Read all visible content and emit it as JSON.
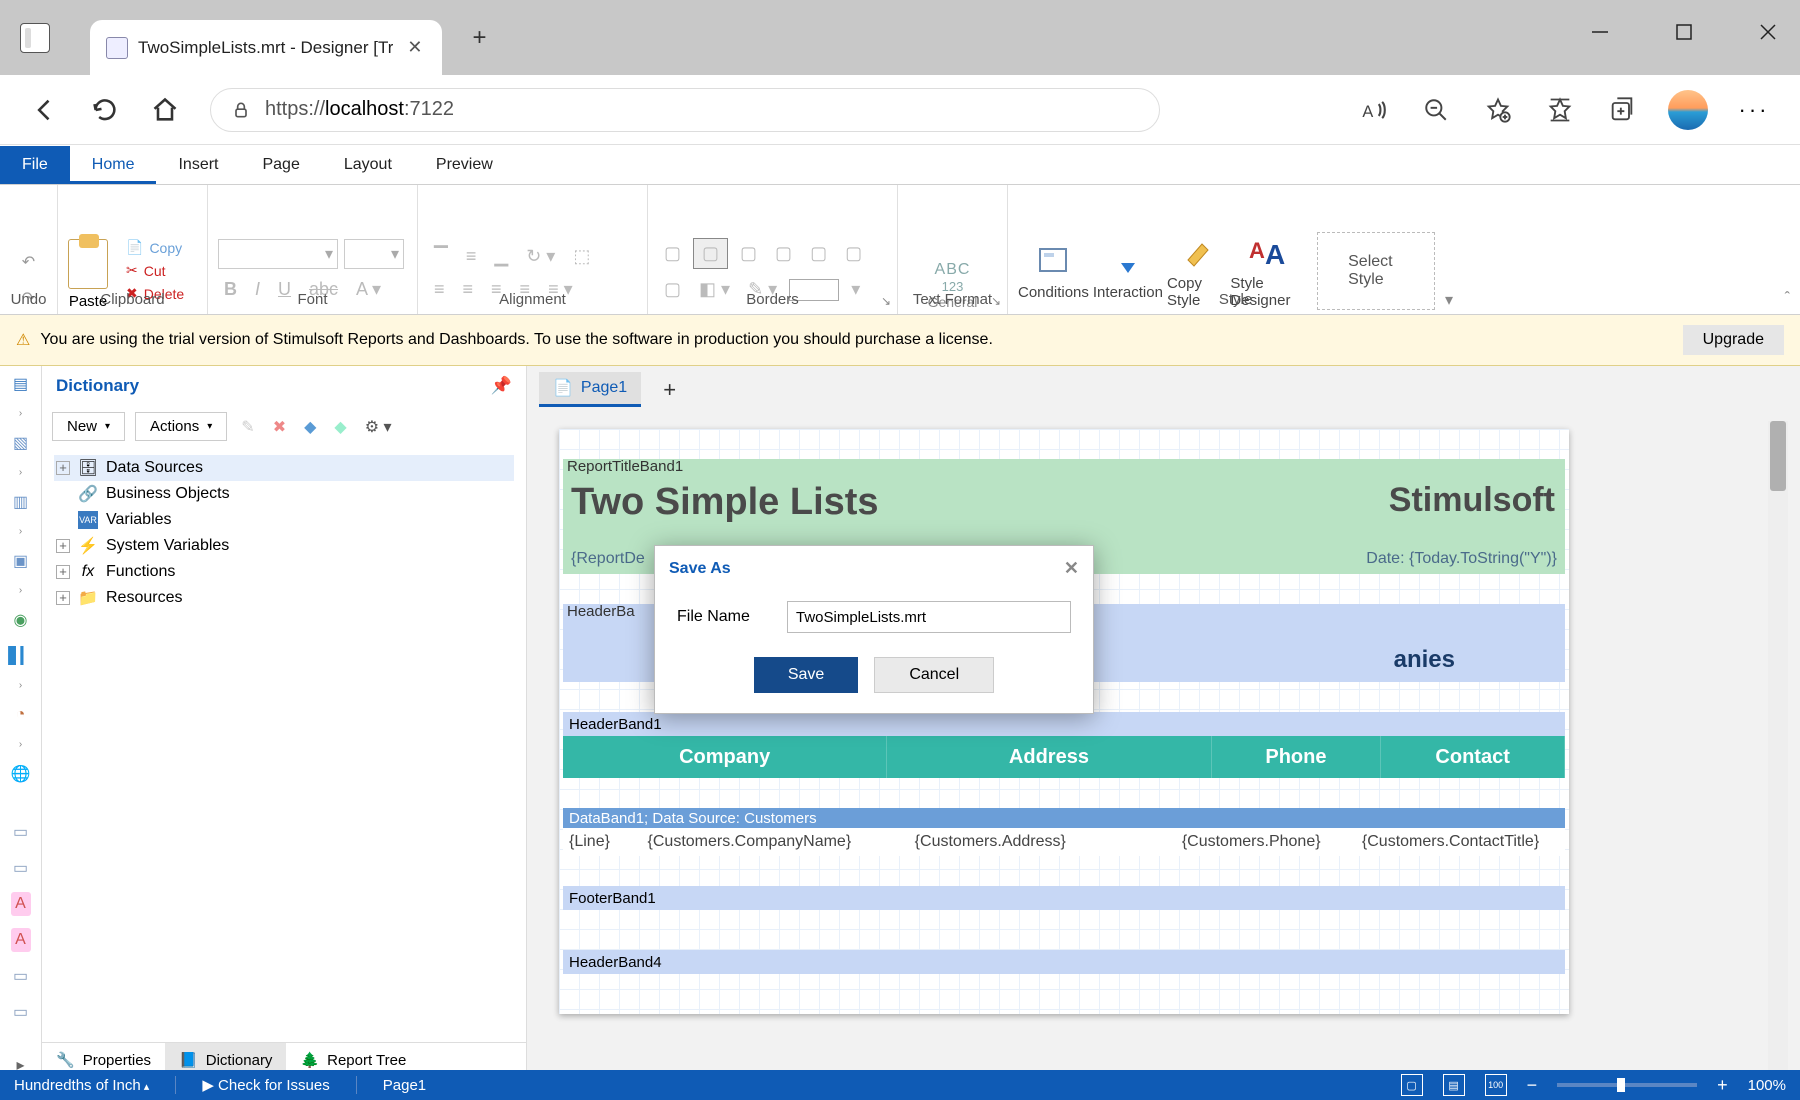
{
  "window": {
    "tab_title": "TwoSimpleLists.mrt - Designer [Tr",
    "new_tab": "+"
  },
  "addr": {
    "scheme": "https://",
    "host": "localhost",
    "port": ":7122"
  },
  "menu": {
    "file": "File",
    "home": "Home",
    "insert": "Insert",
    "page": "Page",
    "layout": "Layout",
    "preview": "Preview"
  },
  "ribbon": {
    "undo_label": "Undo",
    "paste": "Paste",
    "copy": "Copy",
    "cut": "Cut",
    "delete": "Delete",
    "clipboard_label": "Clipboard",
    "font_label": "Font",
    "alignment_label": "Alignment",
    "borders_label": "Borders",
    "textformat_label": "Text Format",
    "style_label": "Style",
    "abc": "ABC",
    "num123": "123",
    "general": "General",
    "conditions": "Conditions",
    "interaction": "Interaction",
    "copy_style": "Copy Style",
    "style_designer": "Style Designer",
    "select_style": "Select Style"
  },
  "trial": {
    "warn": "⚠",
    "text": "You are using the trial version of Stimulsoft Reports and Dashboards. To use the software in production you should purchase a license.",
    "upgrade": "Upgrade"
  },
  "dict": {
    "title": "Dictionary",
    "new_btn": "New",
    "actions_btn": "Actions",
    "tree": {
      "data_sources": "Data Sources",
      "business_objects": "Business Objects",
      "variables": "Variables",
      "system_variables": "System Variables",
      "functions": "Functions",
      "resources": "Resources"
    },
    "tabs": {
      "properties": "Properties",
      "dictionary": "Dictionary",
      "report_tree": "Report Tree"
    }
  },
  "pages": {
    "page1": "Page1",
    "add": "+"
  },
  "report": {
    "report_title_band": "ReportTitleBand1",
    "title": "Two Simple Lists",
    "brand": "Stimulsoft",
    "desc": "{ReportDe",
    "date": "Date: {Today.ToString(\"Y\")}",
    "header_band2": "HeaderBa",
    "companies": "anies",
    "header_band1": "HeaderBand1",
    "cols": {
      "company": "Company",
      "address": "Address",
      "phone": "Phone",
      "contact": "Contact"
    },
    "data_band_label": "DataBand1; Data Source: Customers",
    "data_row": {
      "line": "{Line}",
      "company": "{Customers.CompanyName}",
      "address": "{Customers.Address}",
      "phone": "{Customers.Phone}",
      "contact": "{Customers.ContactTitle}"
    },
    "footer_band1": "FooterBand1",
    "header_band4": "HeaderBand4"
  },
  "dialog": {
    "title": "Save As",
    "filename_label": "File Name",
    "filename_value": "TwoSimpleLists.mrt",
    "save": "Save",
    "cancel": "Cancel"
  },
  "status": {
    "unit": "Hundredths of Inch",
    "check": "Check for Issues",
    "page": "Page1",
    "zoom": "100%"
  }
}
